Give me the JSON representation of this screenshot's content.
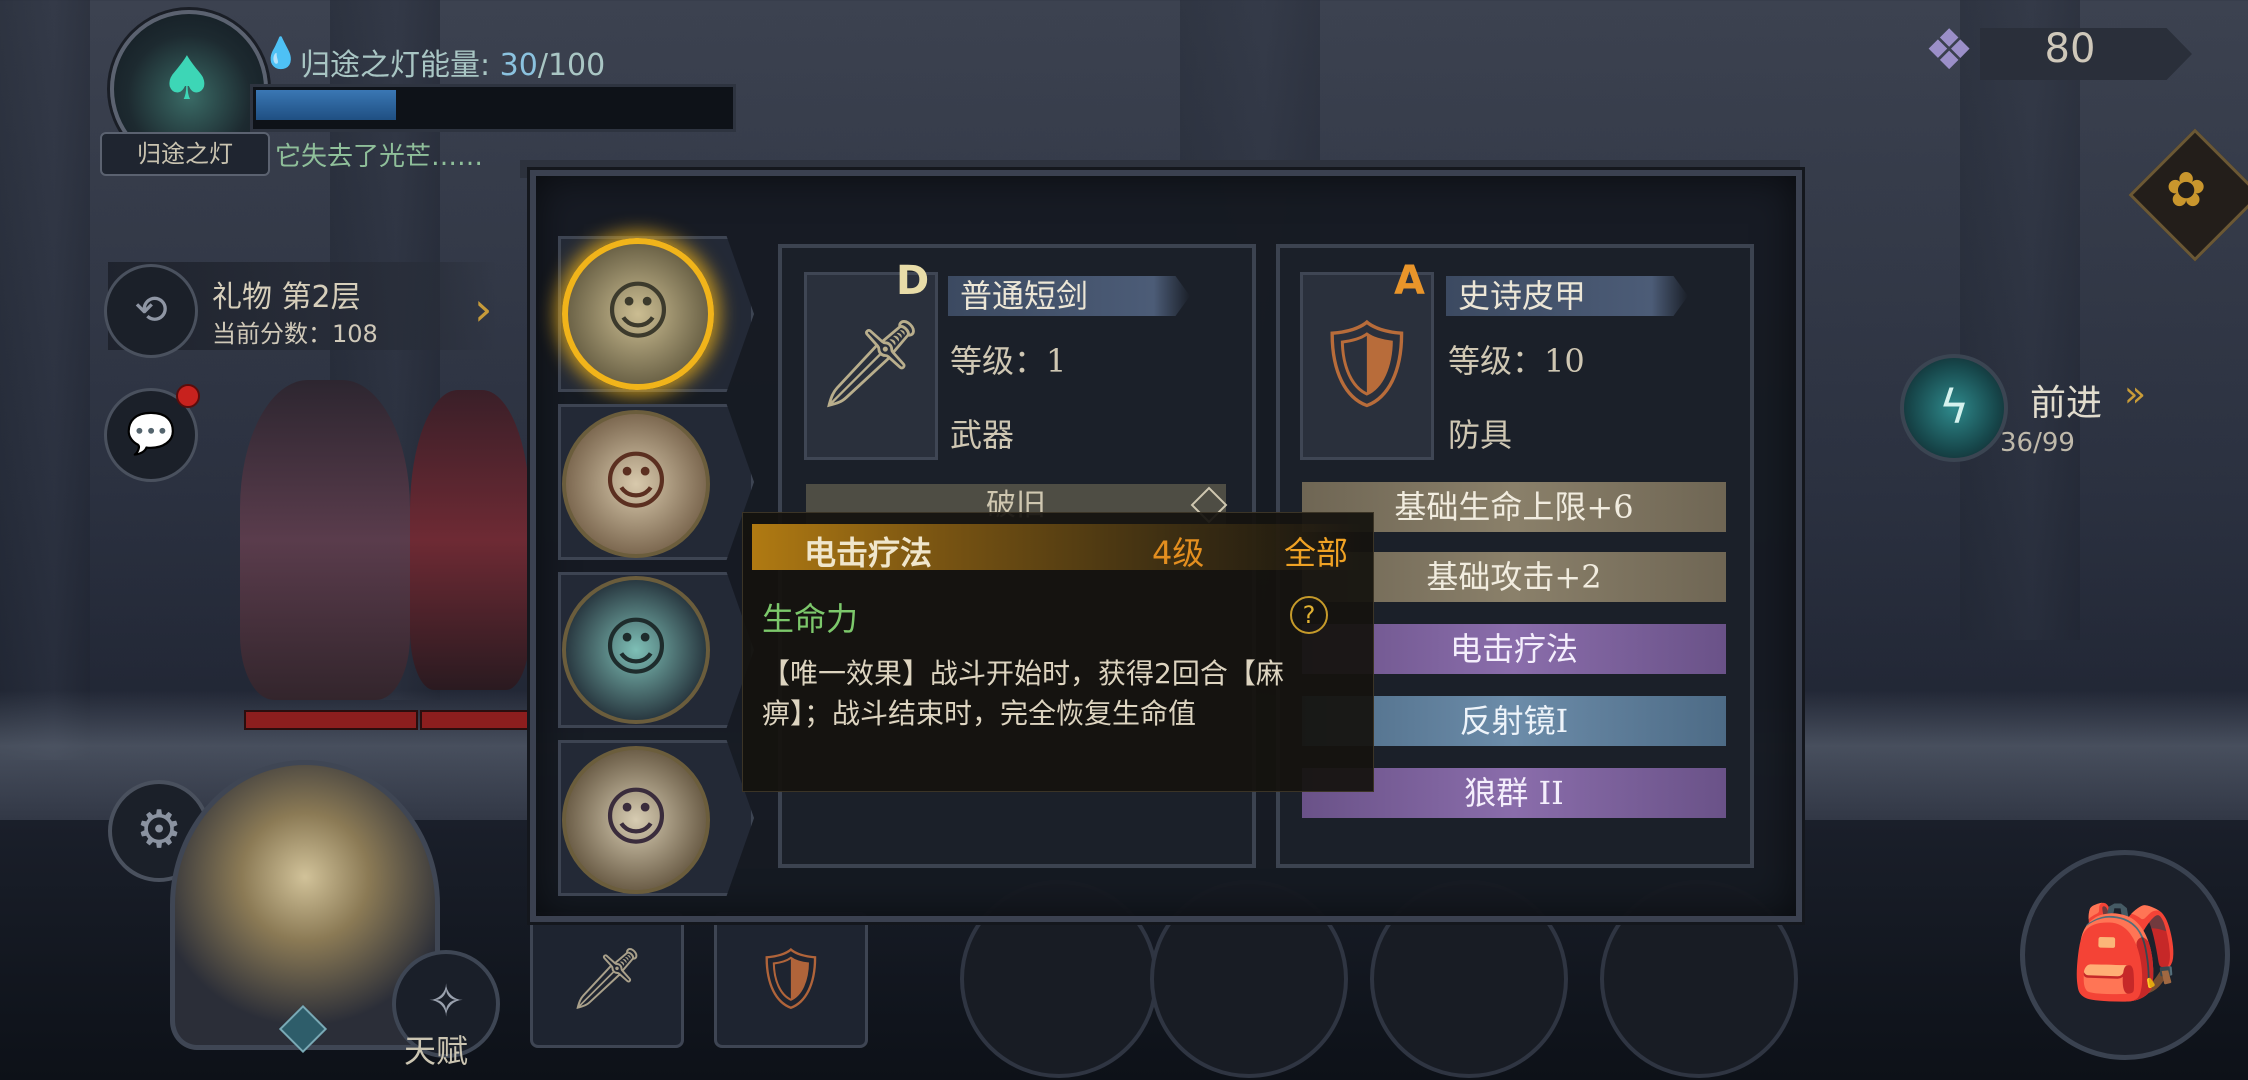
{
  "lantern": {
    "name": "归途之灯",
    "energy_label": "归途之灯能量:",
    "energy_value": "30",
    "energy_max": "/100",
    "energy_fraction": 0.3,
    "description": "它失去了光芒……"
  },
  "floor": {
    "title": "礼物 第2层",
    "score": "当前分数：108"
  },
  "currency": {
    "amount": "80"
  },
  "advance": {
    "label": "前进",
    "arrows": "»",
    "progress": "36/99"
  },
  "talent": {
    "label": "天赋"
  },
  "equipment": [
    {
      "rarity": "D",
      "name": "普通短剑",
      "level": "等级：1",
      "type": "武器",
      "condition": "破旧"
    },
    {
      "rarity": "A",
      "name": "史诗皮甲",
      "level": "等级：10",
      "type": "防具",
      "attributes": [
        {
          "text": "基础生命上限+6",
          "style": "base"
        },
        {
          "text": "基础攻击+2",
          "style": "base"
        },
        {
          "text": "电击疗法",
          "style": "skill"
        },
        {
          "text": "反射镜I",
          "style": "blue"
        },
        {
          "text": "狼群 II",
          "style": "skill"
        }
      ]
    }
  ],
  "tooltip": {
    "name": "电击疗法",
    "level": "4级",
    "scope": "全部",
    "type": "生命力",
    "help": "?",
    "description": "【唯一效果】战斗开始时，获得2回合【麻痹】；战斗结束时，完全恢复生命值"
  },
  "colors": {
    "rarity_D": "#e8dca8",
    "rarity_A": "#e9952a",
    "selected_glow": "#f1b41a",
    "energy_fill": "#3a77b4"
  }
}
